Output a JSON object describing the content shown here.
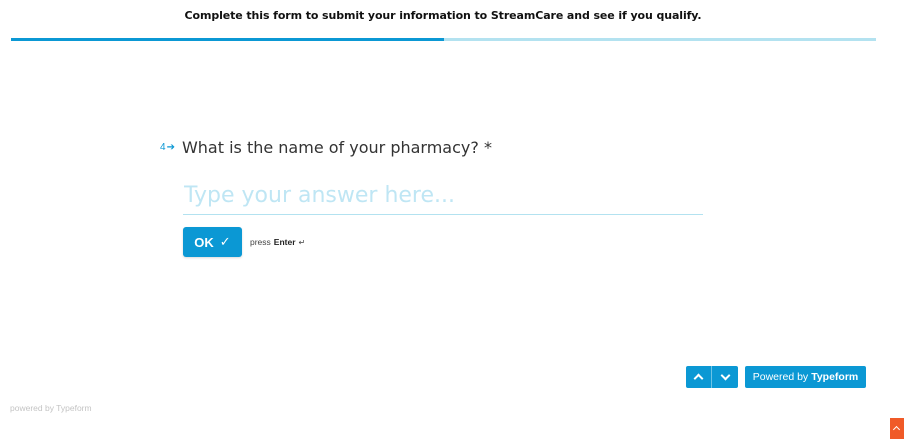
{
  "header": {
    "text": "Complete this form to submit your information to StreamCare and see if you qualify."
  },
  "progress": {
    "fraction": 0.5,
    "colors": {
      "fill": "#0b98d4",
      "track": "#b3e2f0"
    }
  },
  "question": {
    "number": "4",
    "arrow_icon": "arrow-right-icon",
    "text": "What is the name of your pharmacy? *"
  },
  "answer": {
    "value": "",
    "placeholder": "Type your answer here..."
  },
  "ok_button": {
    "label": "OK",
    "icon": "check-icon",
    "icon_glyph": "✓"
  },
  "hint": {
    "prefix": "press",
    "key": "Enter",
    "icon_glyph": "↵"
  },
  "navigation": {
    "up_icon": "chevron-up-icon",
    "down_icon": "chevron-down-icon"
  },
  "powered_button": {
    "prefix": "Powered by",
    "brand": "Typeform"
  },
  "footer": {
    "text": "powered by Typeform"
  },
  "colors": {
    "accent": "#0b98d4",
    "corner_widget": "#f05a28"
  }
}
